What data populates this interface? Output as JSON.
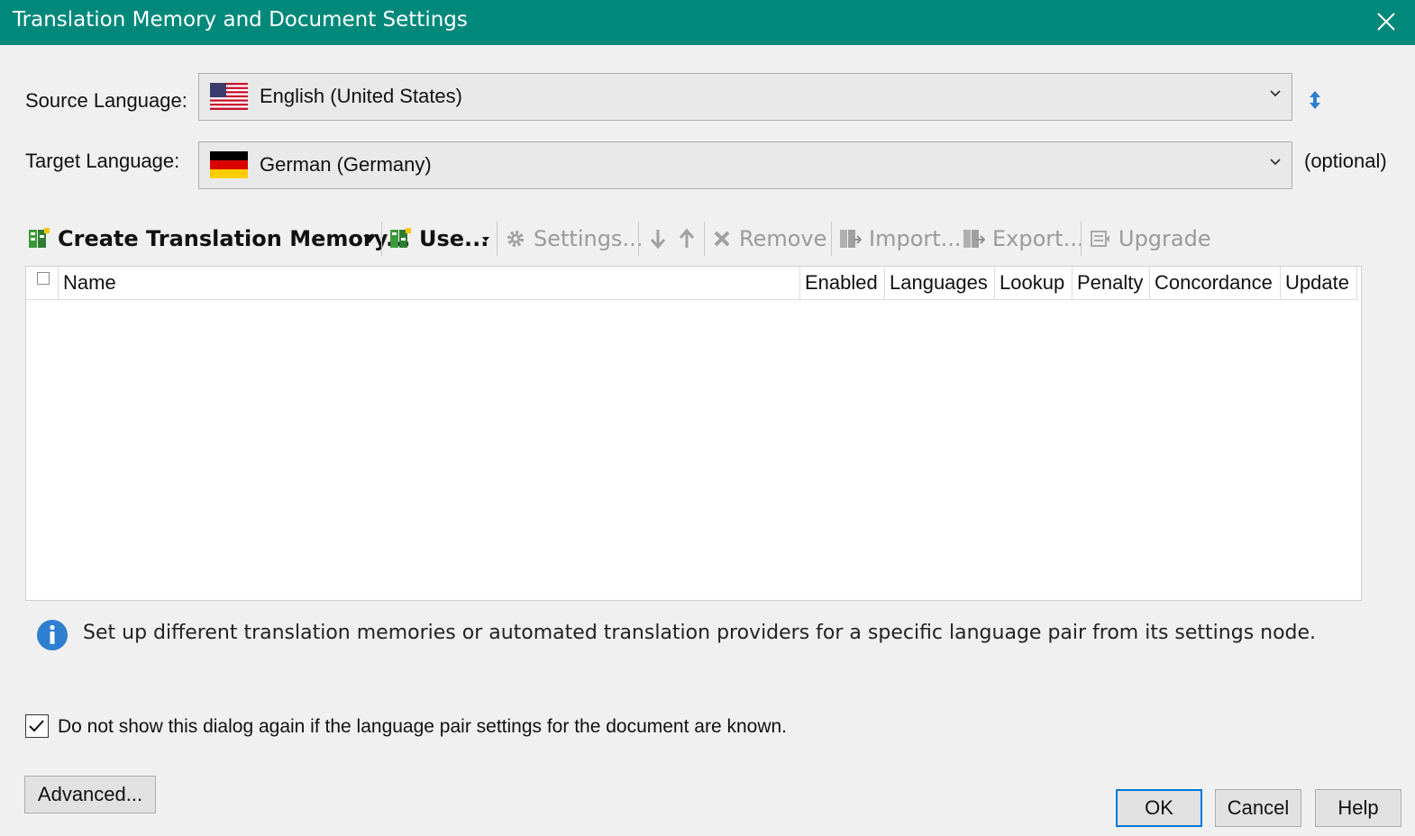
{
  "window": {
    "title": "Translation Memory and Document Settings"
  },
  "source": {
    "label": "Source Language:",
    "value": "English (United States)",
    "flag_icon": "us-flag-icon"
  },
  "target": {
    "label": "Target Language:",
    "value": "German (Germany)",
    "flag_icon": "de-flag-icon",
    "optional_note": "(optional)"
  },
  "toolbar": {
    "create": "Create Translation Memory...",
    "use": "Use...",
    "settings": "Settings...",
    "remove": "Remove",
    "import": "Import...",
    "export": "Export...",
    "upgrade": "Upgrade"
  },
  "grid": {
    "columns": [
      "Name",
      "Enabled",
      "Languages",
      "Lookup",
      "Penalty",
      "Concordance",
      "Update"
    ],
    "rows": []
  },
  "info": {
    "text": "Set up different translation memories or automated translation providers for a specific language pair from its settings node."
  },
  "dont_show": {
    "label": "Do not show this dialog again if the language pair settings for the document are known.",
    "checked": true
  },
  "buttons": {
    "advanced": "Advanced...",
    "ok": "OK",
    "cancel": "Cancel",
    "help": "Help"
  },
  "colors": {
    "titlebar": "#00897b",
    "accent": "#0078d7",
    "info_icon": "#2f7fd1"
  }
}
